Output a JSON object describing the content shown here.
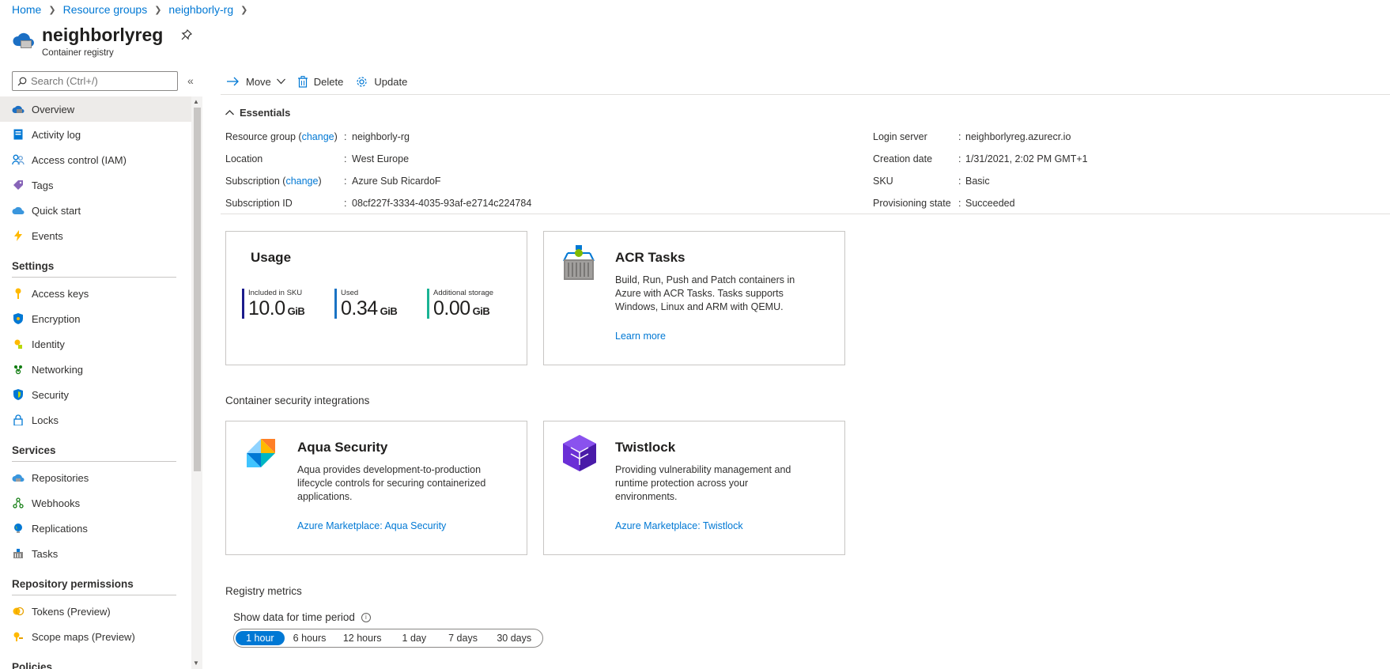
{
  "breadcrumb": [
    "Home",
    "Resource groups",
    "neighborly-rg"
  ],
  "header": {
    "title": "neighborlyreg",
    "subtitle": "Container registry"
  },
  "search": {
    "placeholder": "Search (Ctrl+/)"
  },
  "nav": {
    "top": [
      {
        "label": "Overview",
        "icon": "cloud-icon",
        "active": true
      },
      {
        "label": "Activity log",
        "icon": "log-icon"
      },
      {
        "label": "Access control (IAM)",
        "icon": "people-icon"
      },
      {
        "label": "Tags",
        "icon": "tag-icon"
      },
      {
        "label": "Quick start",
        "icon": "quickstart-cloud-icon"
      },
      {
        "label": "Events",
        "icon": "lightning-icon"
      }
    ],
    "settings_title": "Settings",
    "settings": [
      {
        "label": "Access keys",
        "icon": "key-icon"
      },
      {
        "label": "Encryption",
        "icon": "shield-icon"
      },
      {
        "label": "Identity",
        "icon": "identity-key-icon"
      },
      {
        "label": "Networking",
        "icon": "network-icon"
      },
      {
        "label": "Security",
        "icon": "security-shield-icon"
      },
      {
        "label": "Locks",
        "icon": "lock-icon"
      }
    ],
    "services_title": "Services",
    "services": [
      {
        "label": "Repositories",
        "icon": "repo-cloud-icon"
      },
      {
        "label": "Webhooks",
        "icon": "webhook-icon"
      },
      {
        "label": "Replications",
        "icon": "globe-icon"
      },
      {
        "label": "Tasks",
        "icon": "tasks-icon"
      }
    ],
    "repo_perm_title": "Repository permissions",
    "repo_perm": [
      {
        "label": "Tokens (Preview)",
        "icon": "token-icon"
      },
      {
        "label": "Scope maps (Preview)",
        "icon": "scope-icon"
      }
    ],
    "policies_title": "Policies"
  },
  "toolbar": {
    "move": "Move",
    "delete": "Delete",
    "update": "Update"
  },
  "essentials": {
    "title": "Essentials",
    "left": [
      {
        "label": "Resource group",
        "change": "change",
        "value": "neighborly-rg",
        "value_is_link": true
      },
      {
        "label": "Location",
        "value": "West Europe"
      },
      {
        "label": "Subscription",
        "change": "change",
        "value": "Azure Sub RicardoF",
        "value_is_link": true
      },
      {
        "label": "Subscription ID",
        "value": "08cf227f-3334-4035-93af-e2714c224784"
      }
    ],
    "right": [
      {
        "label": "Login server",
        "value": "neighborlyreg.azurecr.io"
      },
      {
        "label": "Creation date",
        "value": "1/31/2021, 2:02 PM GMT+1"
      },
      {
        "label": "SKU",
        "value": "Basic"
      },
      {
        "label": "Provisioning state",
        "value": "Succeeded"
      }
    ]
  },
  "usage": {
    "title": "Usage",
    "metrics": [
      {
        "label": "Included in SKU",
        "value": "10.0",
        "unit": "GiB",
        "color": "#1c1c8c"
      },
      {
        "label": "Used",
        "value": "0.34",
        "unit": "GiB",
        "color": "#1a73c4"
      },
      {
        "label": "Additional storage",
        "value": "0.00",
        "unit": "GiB",
        "color": "#1ab394"
      }
    ]
  },
  "acr_tasks": {
    "title": "ACR Tasks",
    "desc": "Build, Run, Push and Patch containers in Azure with ACR Tasks. Tasks supports Windows, Linux and ARM with QEMU.",
    "link": "Learn more"
  },
  "integrations_title": "Container security integrations",
  "aqua": {
    "title": "Aqua Security",
    "desc": "Aqua provides development-to-production lifecycle controls for securing containerized applications.",
    "link": "Azure Marketplace: Aqua Security"
  },
  "twistlock": {
    "title": "Twistlock",
    "desc": "Providing vulnerability management and runtime protection across your environments.",
    "link": "Azure Marketplace: Twistlock"
  },
  "metrics": {
    "title": "Registry metrics",
    "period_label": "Show data for time period",
    "periods": [
      "1 hour",
      "6 hours",
      "12 hours",
      "1 day",
      "7 days",
      "30 days"
    ],
    "selected": "1 hour"
  },
  "colors": {
    "accent": "#0078d4",
    "active_nav": "#edebe9"
  }
}
